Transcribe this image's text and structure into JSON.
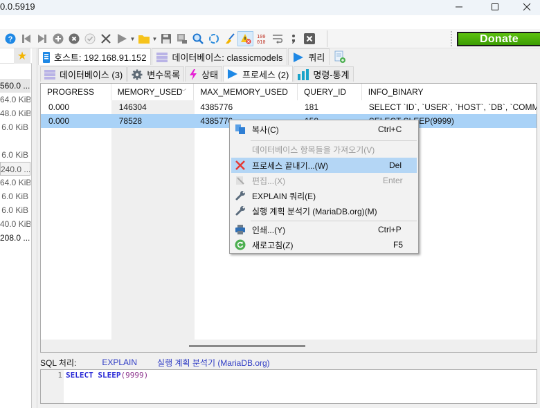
{
  "window": {
    "title": "0.0.5919",
    "minimize_label": "minimize",
    "maximize_label": "maximize",
    "close_label": "close"
  },
  "toolbar": {
    "icons": [
      {
        "name": "help-icon",
        "color": "#1e88e5"
      },
      {
        "name": "first-record-icon"
      },
      {
        "name": "last-record-icon"
      },
      {
        "name": "add-record-icon"
      },
      {
        "name": "delete-record-icon"
      },
      {
        "name": "apply-icon"
      },
      {
        "name": "cancel-icon"
      },
      {
        "name": "run-icon"
      },
      {
        "name": "open-folder-icon"
      },
      {
        "name": "save-icon"
      },
      {
        "name": "save-as-icon"
      },
      {
        "name": "find-icon"
      },
      {
        "name": "refresh-icon"
      },
      {
        "name": "format-sql-icon"
      },
      {
        "name": "stop-on-error-icon",
        "active": true
      },
      {
        "name": "binary-icon"
      },
      {
        "name": "wrap-lines-icon"
      },
      {
        "name": "semicolon-icon"
      },
      {
        "name": "close-tab-icon"
      }
    ],
    "donate_label": "Donate",
    "donate_color": "#4caf0a"
  },
  "left_panel": {
    "sizes": [
      "560.0 ...",
      "64.0 KiB",
      "48.0 KiB",
      "6.0 KiB",
      "",
      "6.0 KiB",
      "240.0 ...",
      "64.0 KiB",
      "6.0 KiB",
      "6.0 KiB",
      "40.0 KiB",
      "208.0 ..."
    ]
  },
  "tabs_top": [
    {
      "label": "호스트: 192.168.91.152",
      "icon": "server-icon",
      "active": true
    },
    {
      "label": "데이터베이스: classicmodels",
      "icon": "database-icon"
    },
    {
      "label": "쿼리",
      "icon": "play-icon"
    },
    {
      "label": "",
      "icon": "new-query-tab-icon"
    }
  ],
  "tabs_sub": [
    {
      "label": "데이터베이스 (3)",
      "icon": "database-icon"
    },
    {
      "label": "변수목록",
      "icon": "gear-icon"
    },
    {
      "label": "상태",
      "icon": "lightning-icon"
    },
    {
      "label": "프로세스 (2)",
      "icon": "play-icon",
      "active": true
    },
    {
      "label": "명령-통계",
      "icon": "bar-chart-icon"
    }
  ],
  "grid": {
    "columns": [
      "PROGRESS",
      "MEMORY_USED",
      "MAX_MEMORY_USED",
      "QUERY_ID",
      "INFO_BINARY"
    ],
    "sort_column": "MEMORY_USED",
    "rows": [
      {
        "cells": [
          "0.000",
          "146304",
          "4385776",
          "181",
          "SELECT `ID`, `USER`, `HOST`, `DB`, `COMMAN"
        ],
        "selected": false
      },
      {
        "cells": [
          "0.000",
          "78528",
          "4385776",
          "158",
          "SELECT SLEEP(9999)"
        ],
        "selected": true
      }
    ]
  },
  "sql_panel": {
    "label": "SQL 처리:",
    "explain_link": "EXPLAIN",
    "analyzer_link": "실행 계획 분석기 (MariaDB.org)",
    "line_number": "1",
    "code_keyword": "SELECT",
    "code_function": "SLEEP",
    "code_open": "(",
    "code_arg": "9999",
    "code_close": ")"
  },
  "context_menu": {
    "items": [
      {
        "label": "복사(C)",
        "shortcut": "Ctrl+C",
        "icon": "copy-icon"
      },
      {
        "separator": true
      },
      {
        "label": "데이터베이스 항목들을 가져오기(V)",
        "shortcut": "",
        "disabled": true
      },
      {
        "label": "프로세스 끝내기...(W)",
        "shortcut": "Del",
        "icon": "kill-process-icon",
        "hover": true
      },
      {
        "label": "편집...(X)",
        "shortcut": "Enter",
        "icon": "edit-icon",
        "disabled": true
      },
      {
        "label": "EXPLAIN 쿼리(E)",
        "shortcut": "",
        "icon": "wrench-icon"
      },
      {
        "label": "실행 계획 분석기 (MariaDB.org)(M)",
        "shortcut": "",
        "icon": "wrench-icon"
      },
      {
        "separator": true
      },
      {
        "label": "인쇄...(Y)",
        "shortcut": "Ctrl+P",
        "icon": "printer-icon"
      },
      {
        "label": "새로고침(Z)",
        "shortcut": "F5",
        "icon": "refresh-icon"
      }
    ]
  },
  "colors": {
    "selection": "#a9d2f7",
    "menu_hover": "#b4d6f5",
    "link": "#2e3bc4"
  }
}
